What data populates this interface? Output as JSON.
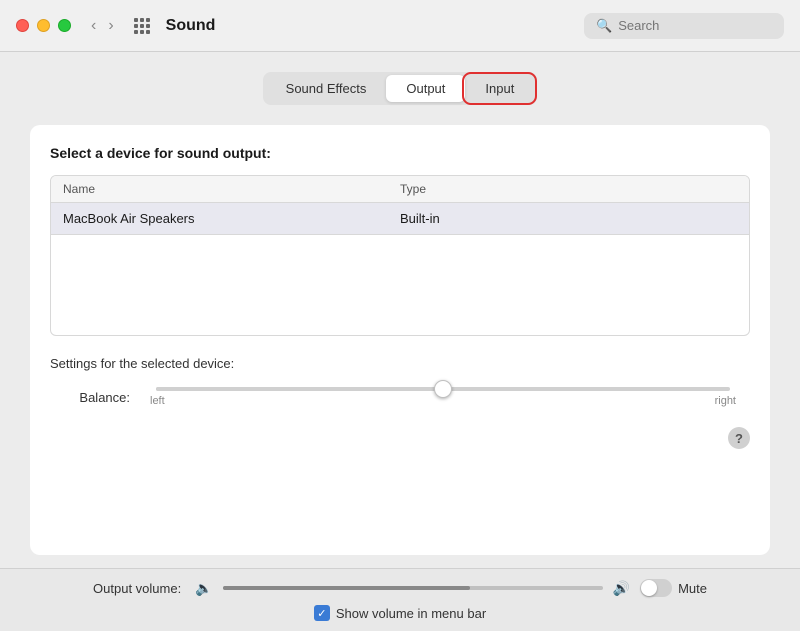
{
  "titlebar": {
    "title": "Sound",
    "search_placeholder": "Search",
    "back_label": "‹",
    "forward_label": "›"
  },
  "tabs": [
    {
      "id": "sound-effects",
      "label": "Sound Effects",
      "state": "normal"
    },
    {
      "id": "output",
      "label": "Output",
      "state": "active"
    },
    {
      "id": "input",
      "label": "Input",
      "state": "highlighted"
    }
  ],
  "panel": {
    "select_title": "Select a device for sound output:",
    "table": {
      "columns": [
        "Name",
        "Type"
      ],
      "rows": [
        {
          "name": "MacBook Air Speakers",
          "type": "Built-in"
        }
      ]
    },
    "settings_title": "Settings for the selected device:",
    "balance_label": "Balance:",
    "balance_left": "left",
    "balance_right": "right",
    "help_label": "?"
  },
  "bottom_bar": {
    "output_volume_label": "Output volume:",
    "mute_label": "Mute",
    "show_volume_label": "Show volume in menu bar",
    "volume_percent": 65
  }
}
